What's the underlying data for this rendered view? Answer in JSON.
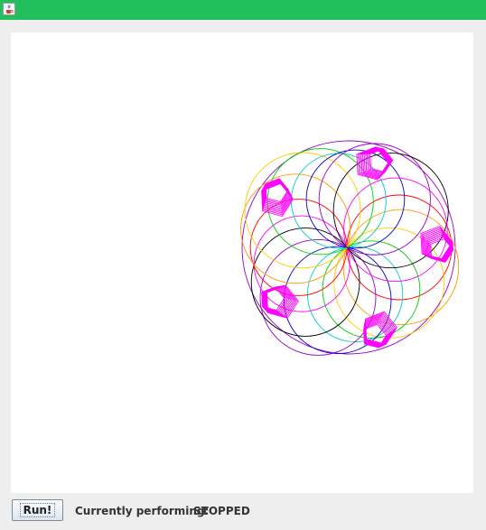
{
  "window": {
    "icon": "java-cup-icon",
    "title_bar_color": "#22c05c"
  },
  "canvas": {
    "background": "#ffffff",
    "drawing": {
      "description_icon": "spirograph-drawing",
      "ring_colors": [
        "#ff0000",
        "#ff9900",
        "#ffcc00",
        "#00cc00",
        "#00cccc",
        "#0000cc",
        "#9900cc",
        "#000000",
        "#ff00ff"
      ],
      "pentagon_color": "#ff00ff",
      "pentagon_count": 5
    }
  },
  "controls": {
    "run_label": "Run!",
    "status_label": "Currently performing:",
    "status_value": "STOPPED"
  }
}
